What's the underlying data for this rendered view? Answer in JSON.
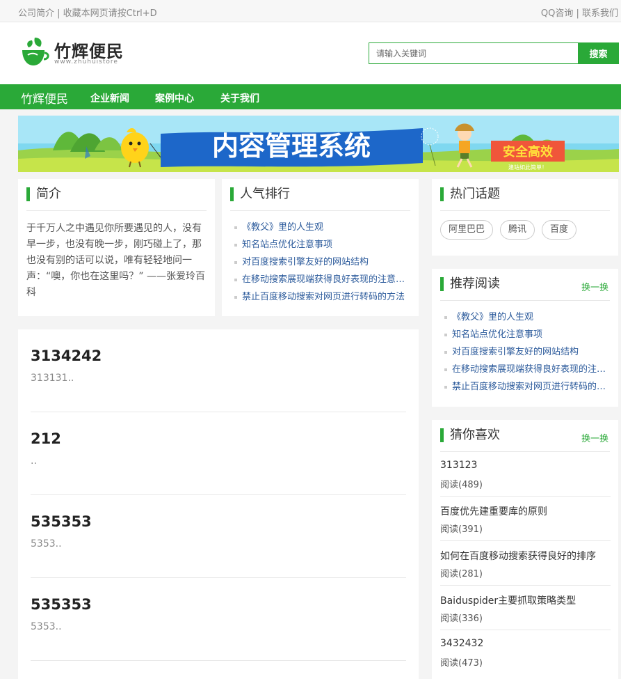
{
  "topbar": {
    "left": "公司简介 | 收藏本网页请按Ctrl+D",
    "right": "QQ咨询 | 联系我们"
  },
  "logo": {
    "name": "竹辉便民",
    "sub": "www.zhuhuistore"
  },
  "search": {
    "placeholder": "请输入关键词",
    "button": "搜索"
  },
  "nav": {
    "brand": "竹辉便民",
    "items": [
      "企业新闻",
      "案例中心",
      "关于我们"
    ]
  },
  "banner": {
    "title": "内容管理系统",
    "badge": "安全高效",
    "caption": "建站如此简单！"
  },
  "intro": {
    "title": "简介",
    "text": "于千万人之中遇见你所要遇见的人，没有早一步，也没有晚一步，刚巧碰上了，那也没有别的话可以说，唯有轻轻地问一声：“噢，你也在这里吗？” ——张爱玲百科"
  },
  "ranking": {
    "title": "人气排行",
    "items": [
      "《教父》里的人生观",
      "知名站点优化注意事项",
      "对百度搜索引擎友好的网站结构",
      "在移动搜索展现端获得良好表现的注意事项",
      "禁止百度移动搜索对网页进行转码的方法"
    ]
  },
  "topics": {
    "title": "热门话题",
    "tags": [
      "阿里巴巴",
      "腾讯",
      "百度"
    ]
  },
  "recommend": {
    "title": "推荐阅读",
    "swap": "换一换",
    "items": [
      "《教父》里的人生观",
      "知名站点优化注意事项",
      "对百度搜索引擎友好的网站结构",
      "在移动搜索展现端获得良好表现的注意事项",
      "禁止百度移动搜索对网页进行转码的方法"
    ]
  },
  "articles": [
    {
      "title": "3134242",
      "desc": "313131.."
    },
    {
      "title": "212",
      "desc": ".."
    },
    {
      "title": "535353",
      "desc": "5353.."
    },
    {
      "title": "535353",
      "desc": "5353.."
    }
  ],
  "guess": {
    "title": "猜你喜欢",
    "swap": "换一换",
    "items": [
      {
        "title": "313123",
        "reads": "阅读(489)"
      },
      {
        "title": "百度优先建重要库的原则",
        "reads": "阅读(391)"
      },
      {
        "title": "如何在百度移动搜索获得良好的排序",
        "reads": "阅读(281)"
      },
      {
        "title": "Baiduspider主要抓取策略类型",
        "reads": "阅读(336)"
      },
      {
        "title": "3432432",
        "reads": "阅读(473)"
      }
    ]
  },
  "colors": {
    "accent": "#2aa938",
    "link": "#2b5a9b"
  }
}
